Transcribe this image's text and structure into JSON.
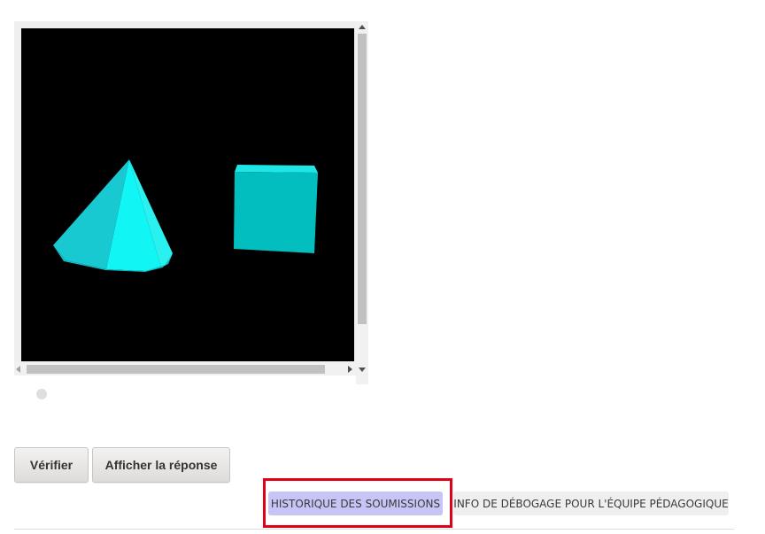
{
  "viewer": {
    "shapes": [
      {
        "kind": "cone",
        "color": "#00ffff"
      },
      {
        "kind": "cube",
        "color": "#00c8c8"
      }
    ],
    "background": "#000000"
  },
  "actions": {
    "check_label": "Vérifier",
    "show_answer_label": "Afficher la réponse"
  },
  "footer_tabs": {
    "history_label": "HISTORIQUE DES SOUMISSIONS",
    "debug_label": "INFO DE DÉBOGAGE POUR L'ÉQUIPE PÉDAGOGIQUE"
  },
  "colors": {
    "highlight_border": "#e30016",
    "history_chip": "#c7c5f5",
    "debug_chip": "#efefef"
  }
}
